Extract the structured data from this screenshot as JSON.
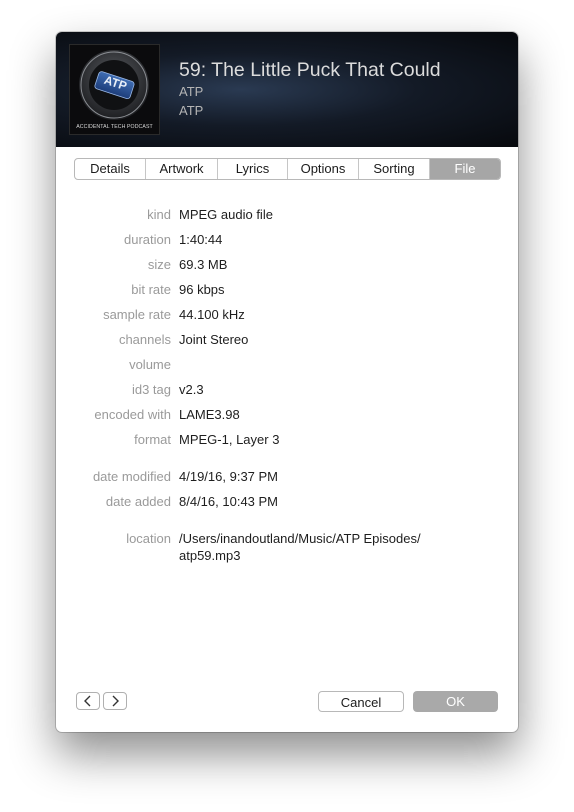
{
  "header": {
    "title": "59: The Little Puck That Could",
    "artist": "ATP",
    "album": "ATP",
    "artwork": {
      "badge_text": "ATP",
      "caption": "ACCIDENTAL TECH PODCAST"
    }
  },
  "tabs": [
    "Details",
    "Artwork",
    "Lyrics",
    "Options",
    "Sorting",
    "File"
  ],
  "selected_tab": "File",
  "file_info": {
    "kind": {
      "label": "kind",
      "value": "MPEG audio file"
    },
    "duration": {
      "label": "duration",
      "value": "1:40:44"
    },
    "size": {
      "label": "size",
      "value": "69.3 MB"
    },
    "bit_rate": {
      "label": "bit rate",
      "value": "96 kbps"
    },
    "sample_rate": {
      "label": "sample rate",
      "value": "44.100 kHz"
    },
    "channels": {
      "label": "channels",
      "value": "Joint Stereo"
    },
    "volume": {
      "label": "volume",
      "value": ""
    },
    "id3_tag": {
      "label": "id3 tag",
      "value": "v2.3"
    },
    "encoded_with": {
      "label": "encoded with",
      "value": "LAME3.98"
    },
    "format": {
      "label": "format",
      "value": "MPEG-1, Layer 3"
    },
    "date_modified": {
      "label": "date modified",
      "value": "4/19/16, 9:37 PM"
    },
    "date_added": {
      "label": "date added",
      "value": "8/4/16, 10:43 PM"
    },
    "location": {
      "label": "location",
      "line1": "/Users/inandoutland/Music/ATP Episodes/",
      "line2": "atp59.mp3"
    }
  },
  "buttons": {
    "cancel": "Cancel",
    "ok": "OK"
  },
  "icons": {
    "previous": "chevron-left-icon",
    "next": "chevron-right-icon"
  }
}
